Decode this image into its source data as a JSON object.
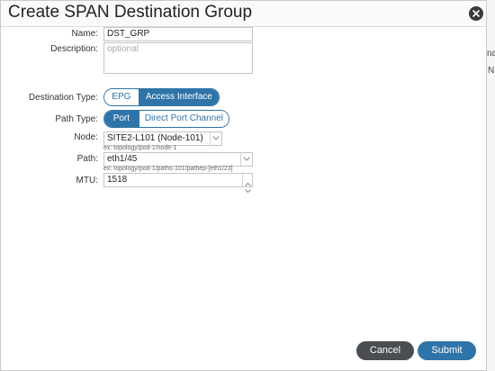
{
  "dialog": {
    "title": "Create SPAN Destination Group"
  },
  "background_fragments": [
    "na",
    "N"
  ],
  "form": {
    "name": {
      "label": "Name:",
      "value": "DST_GRP"
    },
    "description": {
      "label": "Description:",
      "placeholder": "optional"
    },
    "destination_type": {
      "label": "Destination Type:",
      "options": [
        "EPG",
        "Access Interface"
      ],
      "selected": "Access Interface"
    },
    "path_type": {
      "label": "Path Type:",
      "options": [
        "Port",
        "Direct Port Channel"
      ],
      "selected": "Port"
    },
    "node": {
      "label": "Node:",
      "value": "SITE2-L101 (Node-101)",
      "hint": "ex: topology/pod-1/node-1"
    },
    "path": {
      "label": "Path:",
      "value": "eth1/45",
      "hint": "ex: topology/pod-1/paths-101/pathep-[eth1/23]"
    },
    "mtu": {
      "label": "MTU:",
      "value": "1518"
    }
  },
  "footer": {
    "cancel_label": "Cancel",
    "submit_label": "Submit"
  },
  "colors": {
    "accent": "#2f74a8",
    "cancel": "#4a4d51"
  },
  "icons": {
    "close": "close-icon",
    "dropdown": "chevron-down-icon",
    "stepper_up": "caret-up-icon",
    "stepper_down": "caret-down-icon"
  }
}
